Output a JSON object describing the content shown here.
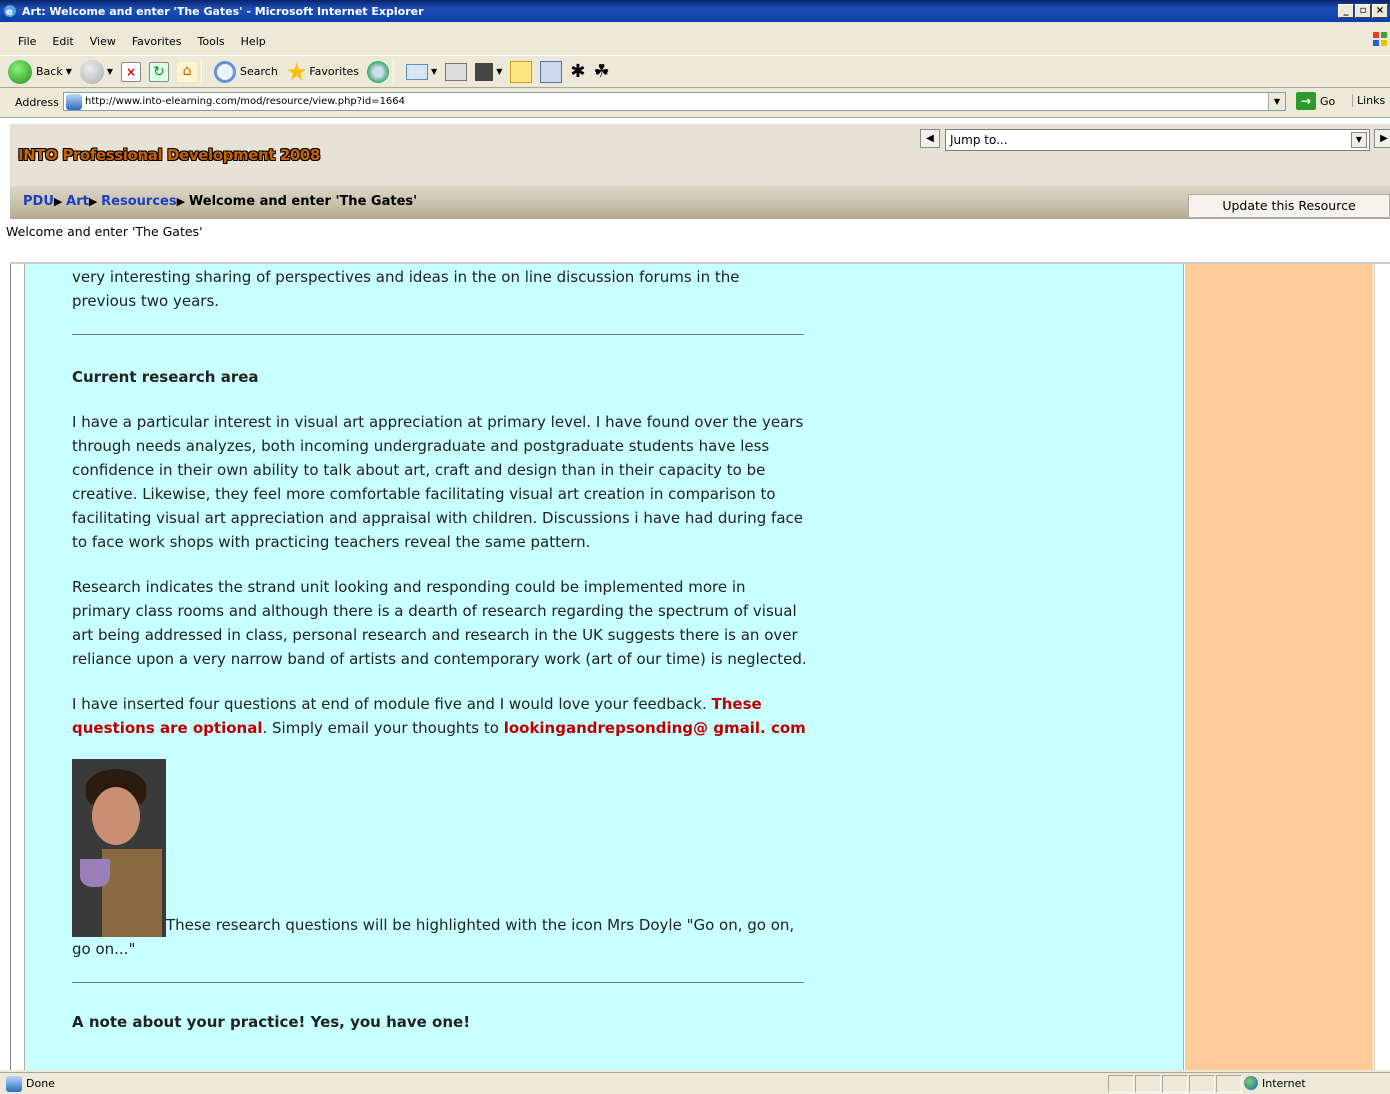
{
  "window": {
    "title": "Art: Welcome and enter 'The Gates' - Microsoft Internet Explorer"
  },
  "menu": [
    "File",
    "Edit",
    "View",
    "Favorites",
    "Tools",
    "Help"
  ],
  "toolbar": {
    "back_label": "Back",
    "search_label": "Search",
    "favorites_label": "Favorites"
  },
  "address": {
    "label": "Address",
    "url": "http://www.into-elearning.com/mod/resource/view.php?id=1664",
    "go_label": "Go",
    "links_label": "Links"
  },
  "site": {
    "title": "INTO Professional Development 2008",
    "jump_placeholder": "Jump to..."
  },
  "breadcrumb": {
    "items": [
      "PDU",
      "Art",
      "Resources"
    ],
    "current": "Welcome and enter 'The Gates'"
  },
  "page": {
    "update_button": "Update this Resource",
    "subtitle": "Welcome and enter 'The Gates'"
  },
  "article": {
    "intro": "very interesting sharing of perspectives and ideas in the on line discussion forums in the previous two years.",
    "heading": "Current research area",
    "para1": "I have a particular interest in visual art appreciation at primary level. I have found over the years through needs analyzes, both incoming undergraduate and postgraduate students have less confidence in their own ability to talk about art, craft and design than in their capacity to be creative. Likewise, they feel more comfortable facilitating visual art creation in comparison to facilitating visual art appreciation and appraisal with children. Discussions i have had during face to face work shops with practicing teachers reveal the same pattern.",
    "para2": "Research indicates the strand unit looking and responding could be implemented more in primary class rooms and although there is a dearth of research regarding the spectrum of visual art being addressed in class, personal research and research in the UK suggests there is an over reliance upon a very narrow band of artists and contemporary work (art of our time) is neglected.",
    "para3_start": "I have inserted four questions at end of module five and I would love your feedback. ",
    "para3_red": "These questions are optional",
    "para3_mid": ". Simply email your thoughts to ",
    "para3_email": "lookingandrepsonding@ gmail. com",
    "caption": "These research questions will be highlighted with the icon Mrs Doyle  \"Go on, go on, go on...\"",
    "next_heading_partial": "A note about your practice! Yes, you have one!"
  },
  "status": {
    "text": "Done",
    "zone": "Internet"
  }
}
